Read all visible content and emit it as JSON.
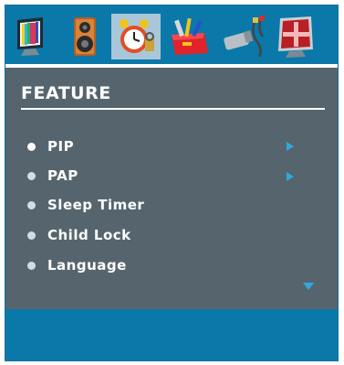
{
  "icon_bar": {
    "icons": [
      {
        "name": "picture-icon",
        "selected": false
      },
      {
        "name": "sound-icon",
        "selected": false
      },
      {
        "name": "feature-icon",
        "selected": true
      },
      {
        "name": "install-icon",
        "selected": false
      },
      {
        "name": "source-icon",
        "selected": false
      },
      {
        "name": "pc-position-icon",
        "selected": false
      }
    ]
  },
  "menu": {
    "title": "FEATURE",
    "items": [
      {
        "label": "PIP",
        "has_submenu": true
      },
      {
        "label": "PAP",
        "has_submenu": true
      },
      {
        "label": "Sleep Timer",
        "has_submenu": false
      },
      {
        "label": "Child Lock",
        "has_submenu": false
      },
      {
        "label": "Language",
        "has_submenu": false
      }
    ],
    "more_indicator": "scroll-down-arrow"
  },
  "colors": {
    "frame": "#0a78a9",
    "panel": "#56656d",
    "selected_tile": "#a9c7d9",
    "arrow": "#2fa9e0",
    "text": "#ffffff"
  }
}
